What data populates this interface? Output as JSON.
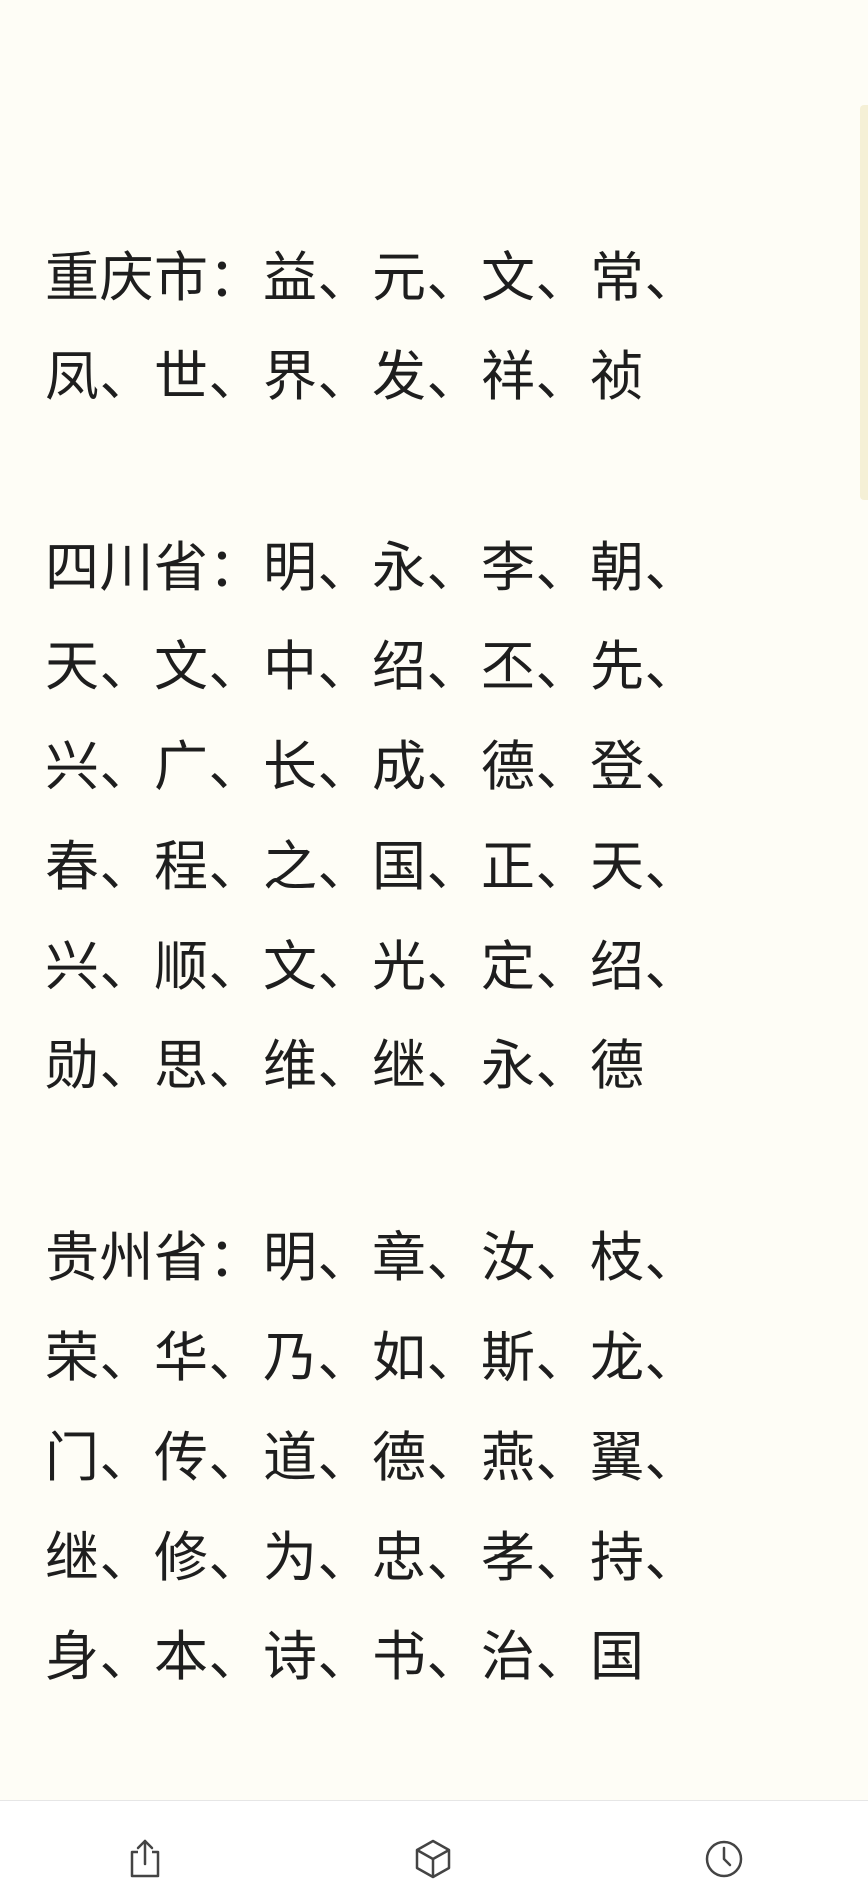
{
  "lines": [
    "重庆市：益、元、文、常、",
    "凤、世、界、发、祥、祯",
    "四川省：明、永、李、朝、",
    "天、文、中、绍、丕、先、",
    "兴、广、长、成、德、登、",
    "春、程、之、国、正、天、",
    "兴、顺、文、光、定、绍、",
    "勋、思、维、继、永、德",
    "贵州省：明、章、汝、枝、",
    "荣、华、乃、如、斯、龙、",
    "门、传、道、德、燕、翼、",
    "继、修、为、忠、孝、持、",
    "身、本、诗、书、治、国"
  ],
  "toolbar": {
    "icons": [
      "share-icon",
      "cube-icon",
      "clock-icon"
    ]
  }
}
